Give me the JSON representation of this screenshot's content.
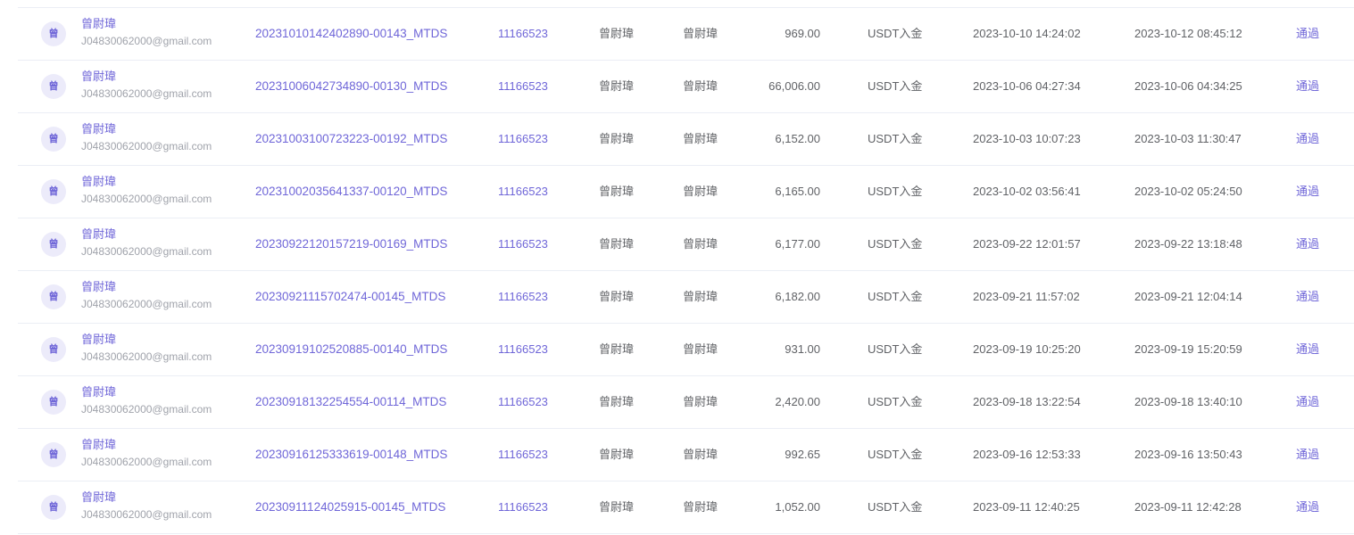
{
  "rows": [
    {
      "avatar": "曾",
      "name": "曾尉瑋",
      "email": "J04830062000@gmail.com",
      "order_id": "20231010142402890-00143_MTDS",
      "account": "11166523",
      "name_a": "曾尉瑋",
      "name_b": "曾尉瑋",
      "amount": "969.00",
      "type": "USDT入金",
      "created": "2023-10-10 14:24:02",
      "processed": "2023-10-12 08:45:12",
      "status": "通過"
    },
    {
      "avatar": "曾",
      "name": "曾尉瑋",
      "email": "J04830062000@gmail.com",
      "order_id": "20231006042734890-00130_MTDS",
      "account": "11166523",
      "name_a": "曾尉瑋",
      "name_b": "曾尉瑋",
      "amount": "66,006.00",
      "type": "USDT入金",
      "created": "2023-10-06 04:27:34",
      "processed": "2023-10-06 04:34:25",
      "status": "通過"
    },
    {
      "avatar": "曾",
      "name": "曾尉瑋",
      "email": "J04830062000@gmail.com",
      "order_id": "20231003100723223-00192_MTDS",
      "account": "11166523",
      "name_a": "曾尉瑋",
      "name_b": "曾尉瑋",
      "amount": "6,152.00",
      "type": "USDT入金",
      "created": "2023-10-03 10:07:23",
      "processed": "2023-10-03 11:30:47",
      "status": "通過"
    },
    {
      "avatar": "曾",
      "name": "曾尉瑋",
      "email": "J04830062000@gmail.com",
      "order_id": "20231002035641337-00120_MTDS",
      "account": "11166523",
      "name_a": "曾尉瑋",
      "name_b": "曾尉瑋",
      "amount": "6,165.00",
      "type": "USDT入金",
      "created": "2023-10-02 03:56:41",
      "processed": "2023-10-02 05:24:50",
      "status": "通過"
    },
    {
      "avatar": "曾",
      "name": "曾尉瑋",
      "email": "J04830062000@gmail.com",
      "order_id": "20230922120157219-00169_MTDS",
      "account": "11166523",
      "name_a": "曾尉瑋",
      "name_b": "曾尉瑋",
      "amount": "6,177.00",
      "type": "USDT入金",
      "created": "2023-09-22 12:01:57",
      "processed": "2023-09-22 13:18:48",
      "status": "通過"
    },
    {
      "avatar": "曾",
      "name": "曾尉瑋",
      "email": "J04830062000@gmail.com",
      "order_id": "20230921115702474-00145_MTDS",
      "account": "11166523",
      "name_a": "曾尉瑋",
      "name_b": "曾尉瑋",
      "amount": "6,182.00",
      "type": "USDT入金",
      "created": "2023-09-21 11:57:02",
      "processed": "2023-09-21 12:04:14",
      "status": "通過"
    },
    {
      "avatar": "曾",
      "name": "曾尉瑋",
      "email": "J04830062000@gmail.com",
      "order_id": "20230919102520885-00140_MTDS",
      "account": "11166523",
      "name_a": "曾尉瑋",
      "name_b": "曾尉瑋",
      "amount": "931.00",
      "type": "USDT入金",
      "created": "2023-09-19 10:25:20",
      "processed": "2023-09-19 15:20:59",
      "status": "通過"
    },
    {
      "avatar": "曾",
      "name": "曾尉瑋",
      "email": "J04830062000@gmail.com",
      "order_id": "20230918132254554-00114_MTDS",
      "account": "11166523",
      "name_a": "曾尉瑋",
      "name_b": "曾尉瑋",
      "amount": "2,420.00",
      "type": "USDT入金",
      "created": "2023-09-18 13:22:54",
      "processed": "2023-09-18 13:40:10",
      "status": "通過"
    },
    {
      "avatar": "曾",
      "name": "曾尉瑋",
      "email": "J04830062000@gmail.com",
      "order_id": "20230916125333619-00148_MTDS",
      "account": "11166523",
      "name_a": "曾尉瑋",
      "name_b": "曾尉瑋",
      "amount": "992.65",
      "type": "USDT入金",
      "created": "2023-09-16 12:53:33",
      "processed": "2023-09-16 13:50:43",
      "status": "通過"
    },
    {
      "avatar": "曾",
      "name": "曾尉瑋",
      "email": "J04830062000@gmail.com",
      "order_id": "20230911124025915-00145_MTDS",
      "account": "11166523",
      "name_a": "曾尉瑋",
      "name_b": "曾尉瑋",
      "amount": "1,052.00",
      "type": "USDT入金",
      "created": "2023-09-11 12:40:25",
      "processed": "2023-09-11 12:42:28",
      "status": "通過"
    }
  ],
  "colors": {
    "accent": "#6f66d8",
    "text": "#606266",
    "muted": "#a0a3ab",
    "avatar_bg": "#ecebfa",
    "divider": "#ebeef5"
  }
}
